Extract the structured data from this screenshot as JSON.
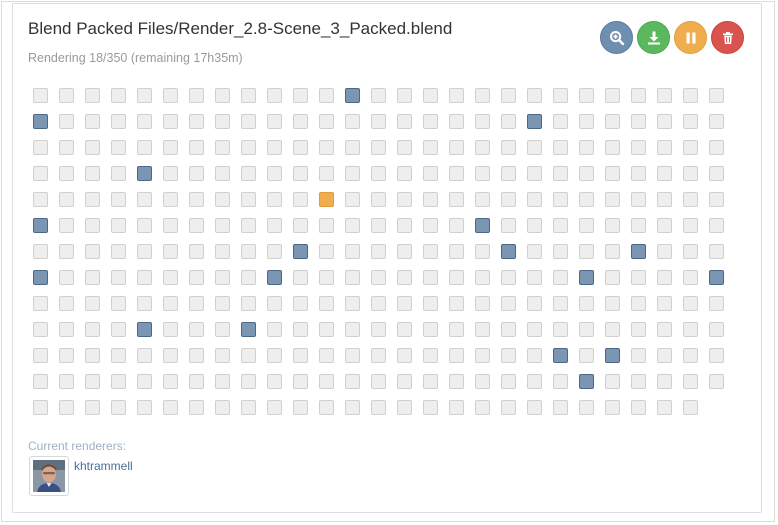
{
  "job": {
    "title": "Blend Packed Files/Render_2.8-Scene_3_Packed.blend",
    "status_text": "Rendering 18/350 (remaining 17h35m)"
  },
  "actions": {
    "view_icon": "magnify-plus-icon",
    "download_icon": "download-icon",
    "pause_icon": "pause-icon",
    "delete_icon": "trash-icon",
    "colors": {
      "view": "#6f8fb1",
      "download": "#5cb85c",
      "pause": "#f0ad4e",
      "delete": "#d9534f"
    }
  },
  "frames": {
    "columns": 27,
    "total": 350,
    "done": [
      [
        0,
        12
      ],
      [
        1,
        0
      ],
      [
        1,
        19
      ],
      [
        3,
        4
      ],
      [
        5,
        0
      ],
      [
        5,
        17
      ],
      [
        6,
        10
      ],
      [
        6,
        18
      ],
      [
        6,
        23
      ],
      [
        7,
        0
      ],
      [
        7,
        9
      ],
      [
        7,
        21
      ],
      [
        7,
        26
      ],
      [
        9,
        4
      ],
      [
        9,
        8
      ],
      [
        10,
        20
      ],
      [
        10,
        22
      ],
      [
        11,
        21
      ]
    ],
    "active": [
      [
        4,
        11
      ]
    ],
    "colors": {
      "pending": "#eeeeee",
      "done": "#7a96b2",
      "active": "#f0ad4e"
    }
  },
  "renderers": {
    "label": "Current renderers:",
    "users": [
      {
        "name": "khtrammell",
        "avatar_icon": "user-photo-avatar"
      }
    ]
  }
}
